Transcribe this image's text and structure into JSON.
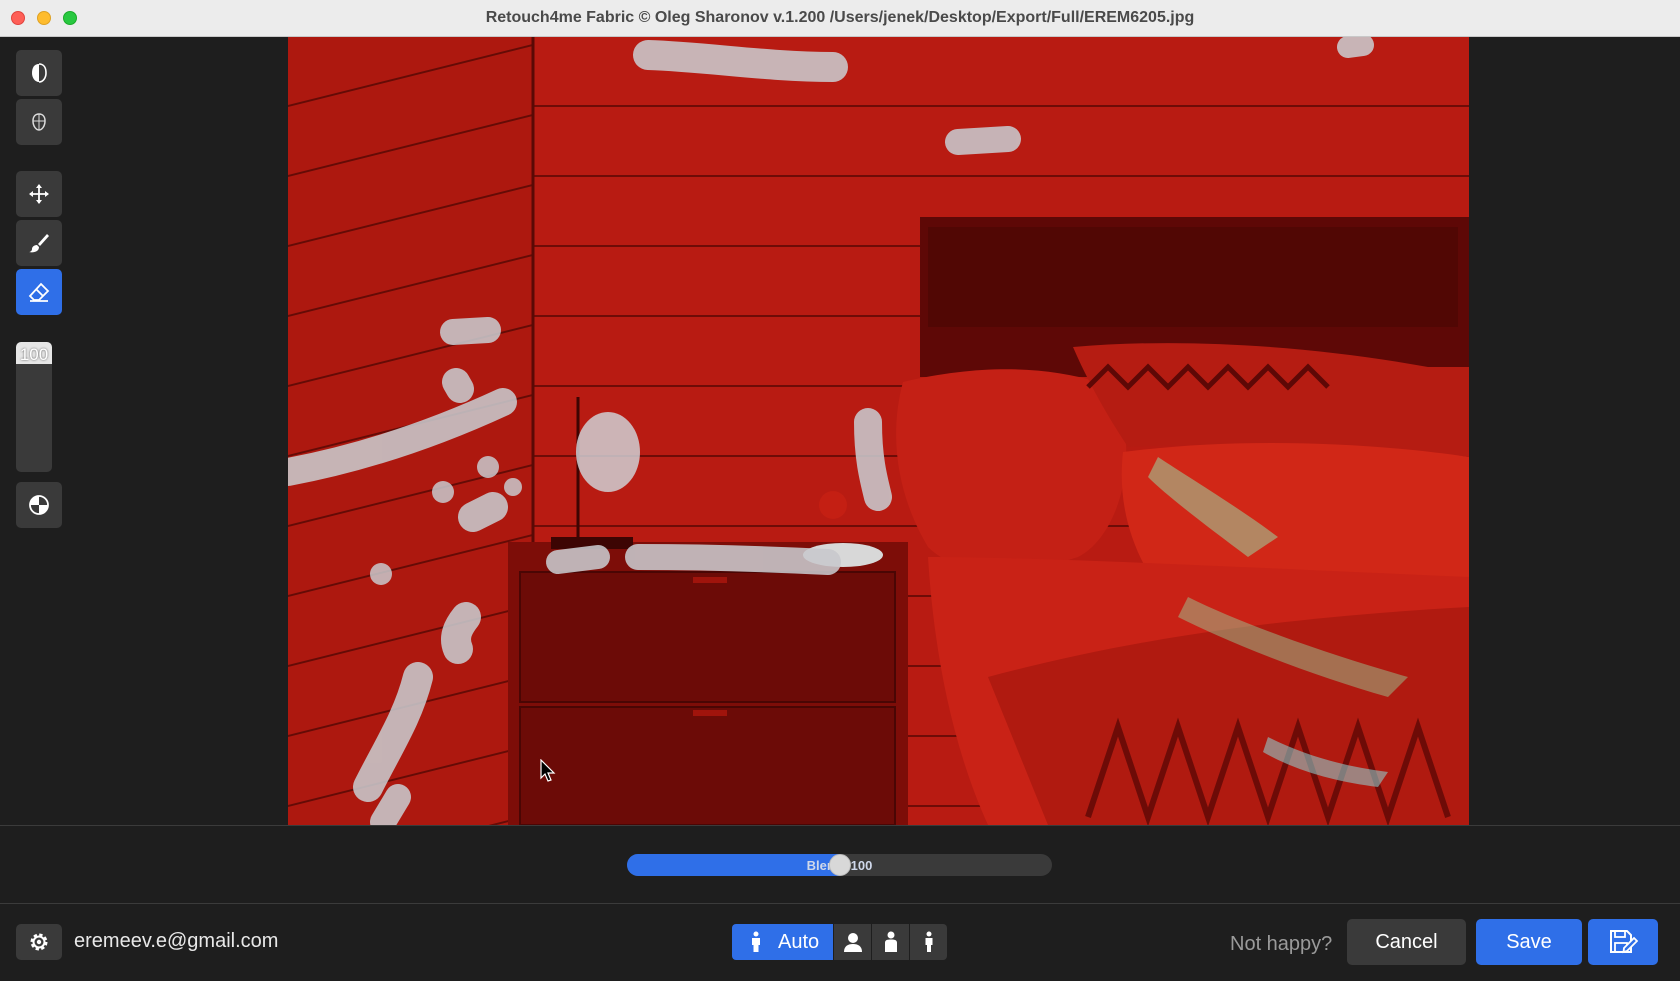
{
  "window": {
    "title": "Retouch4me Fabric © Oleg Sharonov v.1.200 /Users/jenek/Desktop/Export/Full/EREM6205.jpg"
  },
  "toolbar": {
    "tools": [
      {
        "name": "mask-half-icon",
        "active": false
      },
      {
        "name": "face-mask-icon",
        "active": false
      },
      {
        "name": "move-icon",
        "active": false
      },
      {
        "name": "brush-icon",
        "active": false
      },
      {
        "name": "eraser-icon",
        "active": true
      },
      {
        "name": "contrast-view-icon",
        "active": false
      }
    ],
    "brush_size": "100"
  },
  "blend": {
    "label": "Blend: 100",
    "value": 50
  },
  "footer": {
    "account_email": "eremeev.e@gmail.com",
    "mode_auto_label": "Auto",
    "not_happy_label": "Not happy?",
    "cancel_label": "Cancel",
    "save_label": "Save"
  },
  "colors": {
    "accent": "#2f6fe8",
    "panel": "#1e1e1e",
    "button": "#3a3a3a",
    "overlay_mask": "#b01a10"
  }
}
